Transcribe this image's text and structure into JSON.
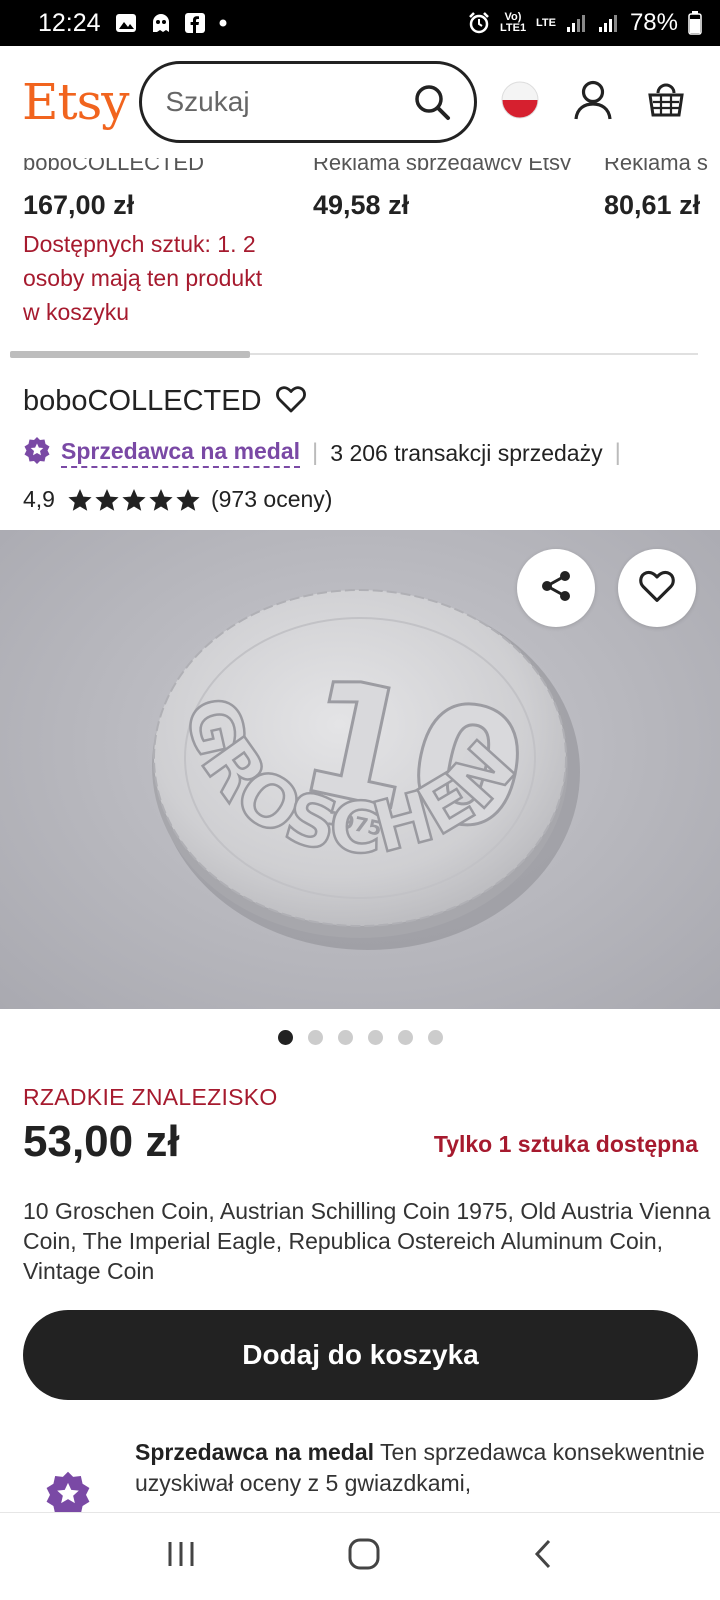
{
  "status_bar": {
    "time": "12:24",
    "battery": "78%",
    "network": "LTE",
    "volte": "Vo) LTE1"
  },
  "header": {
    "logo": "Etsy",
    "search_placeholder": "Szukaj"
  },
  "other_listings": [
    {
      "top_text": "boboCOLLECTED",
      "price": "167,00 zł",
      "stock": "Dostępnych sztuk: 1. 2 osoby mają ten produkt w koszyku"
    },
    {
      "top_text": "Reklama sprzedawcy Etsy",
      "price": "49,58 zł",
      "stock": ""
    },
    {
      "top_text": "Reklama s",
      "price": "80,61 zł",
      "stock": ""
    }
  ],
  "shop": {
    "name": "boboCOLLECTED",
    "star_seller_label": "Sprzedawca na medal",
    "sales": "3 206 transakcji sprzedaży",
    "rating_value": "4,9",
    "rating_stars": 5,
    "rating_count": "(973 oceny)"
  },
  "gallery": {
    "image_count": 6,
    "active_index": 0,
    "coin_denomination": "10",
    "coin_text": "GROSCHEN",
    "coin_year": "1975"
  },
  "listing": {
    "tag": "RZADKIE ZNALEZISKO",
    "price": "53,00 zł",
    "availability": "Tylko 1 sztuka dostępna",
    "title": "10 Groschen Coin, Austrian Schilling Coin 1975, Old Austria Vienna Coin, The Imperial Eagle, Republica Ostereich Aluminum Coin, Vintage Coin",
    "add_to_cart": "Dodaj do koszyka"
  },
  "star_seller_info": {
    "title": "Sprzedawca na medal",
    "text": "Ten sprzedawca konsekwentnie uzyskiwał oceny z 5 gwiazdkami,"
  },
  "colors": {
    "etsy_orange": "#f1641e",
    "accent_red": "#a61a2e",
    "star_seller_purple": "#7a49a5",
    "button_dark": "#222222"
  }
}
